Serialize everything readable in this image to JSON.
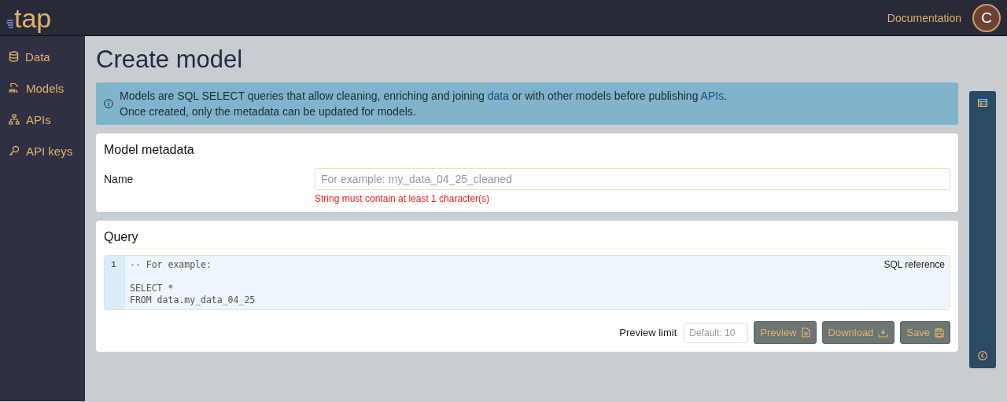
{
  "header": {
    "logo": "tap",
    "link": "Documentation",
    "avatar": "C"
  },
  "sidebar": {
    "items": [
      {
        "label": "Data"
      },
      {
        "label": "Models"
      },
      {
        "label": "APIs"
      },
      {
        "label": "API keys"
      }
    ]
  },
  "page": {
    "title": "Create model"
  },
  "info": {
    "lines": [
      [
        {
          "kind": "text",
          "text": "Models are SQL SELECT queries that allow cleaning, enriching and joining "
        },
        {
          "kind": "link",
          "text": "data"
        },
        {
          "kind": "text",
          "text": " or with other models before publishing "
        },
        {
          "kind": "link",
          "text": "APIs"
        },
        {
          "kind": "text",
          "text": "."
        }
      ],
      [
        {
          "kind": "text",
          "text": "Once created, only the metadata can be updated for models."
        }
      ]
    ]
  },
  "metadata": {
    "title": "Model metadata",
    "name_label": "Name",
    "name_placeholder": "For example: my_data_04_25_cleaned",
    "error": "String must contain at least 1 character(s)"
  },
  "query": {
    "title": "Query",
    "line_number": "1",
    "placeholder": "-- For example:\n\nSELECT *\nFROM data.my_data_04_25",
    "reference_link": "SQL reference",
    "preview_limit_label": "Preview limit",
    "preview_limit_placeholder": "Default: 10",
    "buttons": [
      {
        "label": "Preview"
      },
      {
        "label": "Download"
      },
      {
        "label": "Save"
      }
    ]
  }
}
